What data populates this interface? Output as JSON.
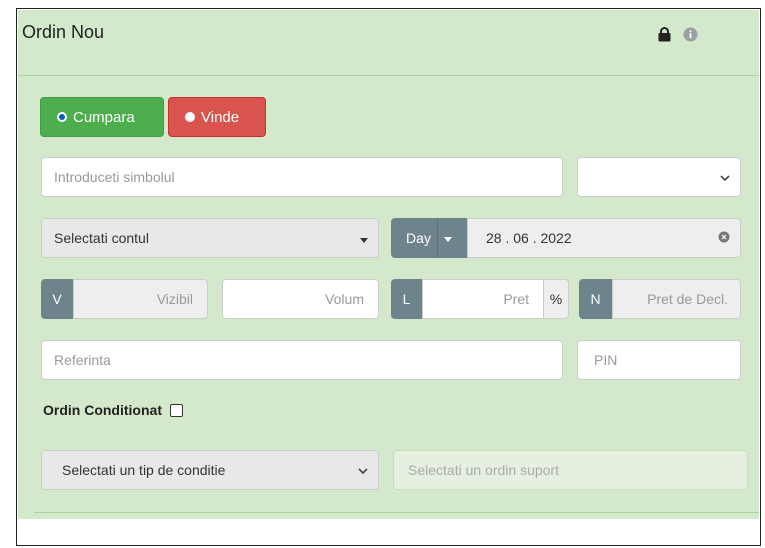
{
  "header": {
    "title": "Ordin Nou",
    "lock_icon": "lock-icon",
    "info_icon": "info-circle-icon"
  },
  "side": {
    "buy_label": "Cumpara",
    "sell_label": "Vinde",
    "buy_color": "#4cae4c",
    "sell_color": "#d9534f",
    "selected": "Cumpara"
  },
  "symbol": {
    "placeholder": "Introduceti simbolul",
    "dropdown_value": ""
  },
  "account": {
    "value": "Selectati contul"
  },
  "validity": {
    "type": "Day",
    "date": "28 . 06 . 2022"
  },
  "visible": {
    "addon": "V",
    "placeholder": "Vizibil"
  },
  "volume": {
    "placeholder": "Volum"
  },
  "price": {
    "addon": "L",
    "placeholder": "Pret",
    "percent": "%"
  },
  "trigger": {
    "addon": "N",
    "placeholder": "Pret de Decl."
  },
  "reference": {
    "placeholder": "Referinta"
  },
  "pin": {
    "placeholder": "PIN"
  },
  "conditional": {
    "label": "Ordin Conditionat",
    "checked": false
  },
  "condition_type": {
    "value": "Selectati un tip de conditie"
  },
  "support_order": {
    "placeholder": "Selectati un ordin suport"
  },
  "colors": {
    "panel_bg": "#d4e9cb",
    "addon_bg": "#6e848d"
  }
}
